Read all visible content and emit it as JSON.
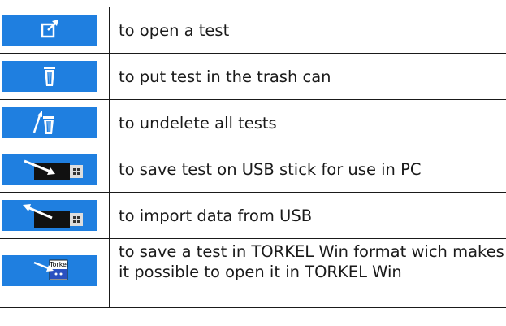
{
  "rows": [
    {
      "icon": "open-test-icon",
      "text": "to open a test"
    },
    {
      "icon": "trash-can-icon",
      "text": "to put test in the trash can"
    },
    {
      "icon": "undelete-icon",
      "text": "to undelete all tests"
    },
    {
      "icon": "usb-export-icon",
      "text": "to save test on USB stick for use in PC"
    },
    {
      "icon": "usb-import-icon",
      "text": "to import data from USB"
    },
    {
      "icon": "torkel-win-icon",
      "text": "to save a test in TORKEL Win format wich makes it possible to open it in TORKEL Win",
      "icon_label": "Torkel"
    }
  ],
  "colors": {
    "button": "#1f7fe0",
    "text": "#1a1a1a",
    "usb": "#111111"
  }
}
